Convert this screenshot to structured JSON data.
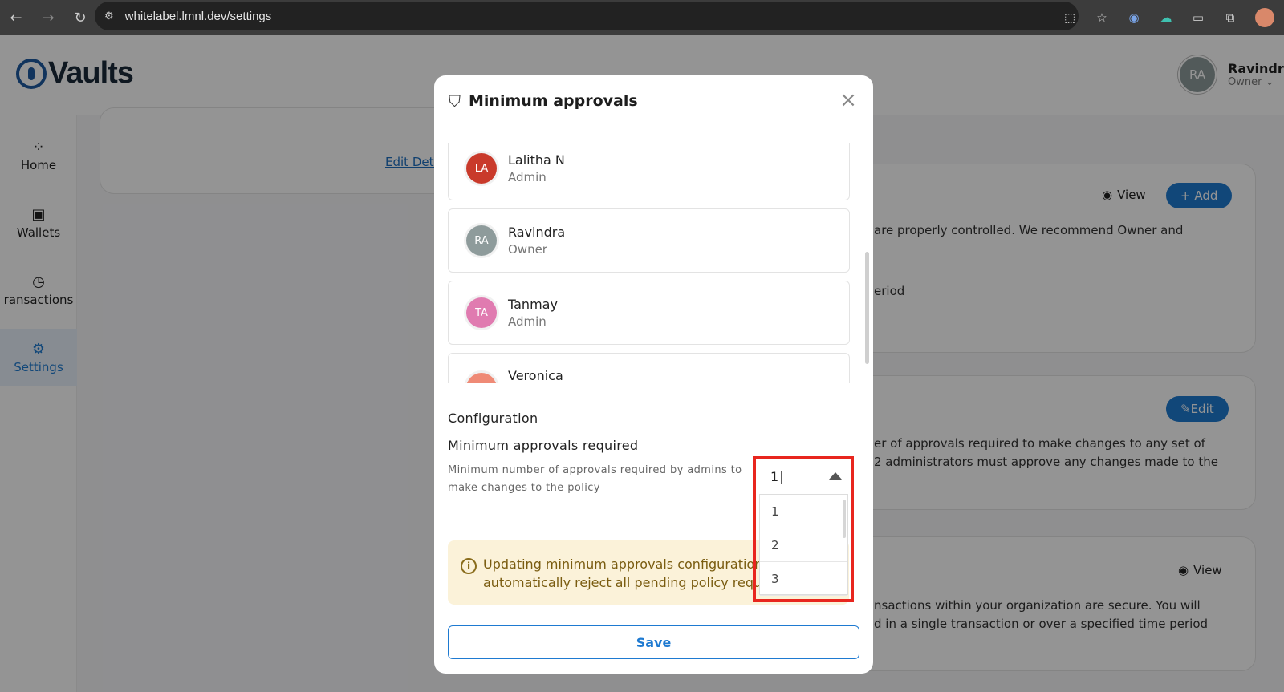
{
  "browser": {
    "url": "whitelabel.lmnl.dev/settings",
    "back_icon": "arrow-left-icon",
    "forward_icon": "arrow-right-icon",
    "reload_icon": "reload-icon"
  },
  "app": {
    "logo_text": "Vaults",
    "user": {
      "initials": "RA",
      "name": "Ravindra",
      "role": "Owner"
    },
    "sidebar": [
      {
        "label": "Home",
        "icon": "grid-icon"
      },
      {
        "label": "Wallets",
        "icon": "wallet-icon"
      },
      {
        "label": "ransactions",
        "icon": "clock-icon"
      },
      {
        "label": "Settings",
        "icon": "gear-icon",
        "active": true
      }
    ],
    "edit_details_link": "Edit Deta",
    "cards": {
      "view_label": "View",
      "add_label": "+ Add",
      "edit_label": "Edit",
      "card1_line1": "are properly controlled. We recommend Owner and",
      "card1_line2": "eriod",
      "card2_line1": "er of approvals required to make changes to any set of",
      "card2_line2": "2 administrators must approve any changes made to the",
      "card3_line1": "nsactions within your organization are secure. You will",
      "card3_line2": "d in a single transaction or over a specified time period"
    }
  },
  "modal": {
    "title": "Minimum approvals",
    "members": [
      {
        "initials": "LA",
        "name": "Lalitha N",
        "role": "Admin",
        "color": "#c93a2b"
      },
      {
        "initials": "RA",
        "name": "Ravindra",
        "role": "Owner",
        "color": "#8e9b9b"
      },
      {
        "initials": "TA",
        "name": "Tanmay",
        "role": "Admin",
        "color": "#e07bb0"
      },
      {
        "initials": "",
        "name": "Veronica",
        "role": "",
        "color": "#ef8a76"
      }
    ],
    "config_title": "Configuration",
    "requirement_title": "Minimum approvals required",
    "requirement_desc": "Minimum number of approvals required by admins to make changes to the policy",
    "select_value": "1",
    "options": [
      "1",
      "2",
      "3"
    ],
    "warning": {
      "line1": "Updating minimum approvals configuration",
      "line2": "automatically reject all pending policy reque"
    },
    "save_label": "Save"
  }
}
